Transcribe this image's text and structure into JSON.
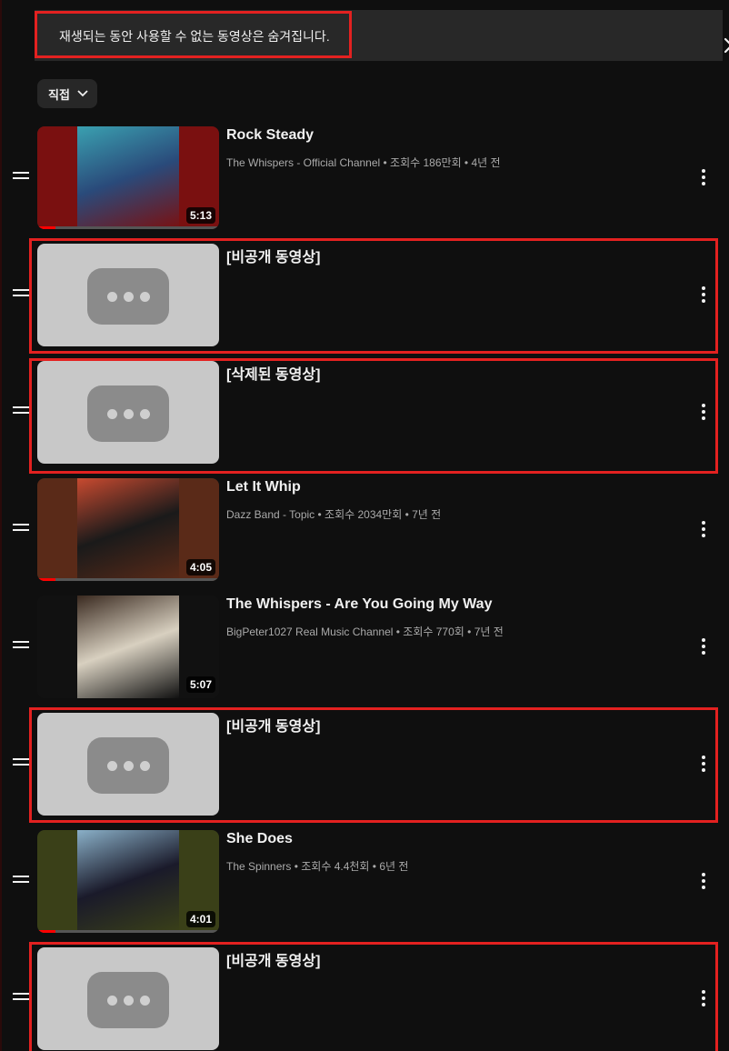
{
  "banner": {
    "message": "재생되는 동안 사용할 수 없는 동영상은 숨겨집니다.",
    "close_icon": "close-icon"
  },
  "sort_chip": {
    "label": "직접",
    "icon": "chevron-down-icon"
  },
  "videos": [
    {
      "title": "Rock Steady",
      "meta": "The Whispers - Official Channel • 조회수 186만회 • 4년 전",
      "duration": "5:13",
      "available": true,
      "progress": 0.1,
      "thumb_colors": [
        "#7a1010",
        "#2a4a7a",
        "#3aa0b0"
      ]
    },
    {
      "title": "[비공개 동영상]",
      "meta": "",
      "duration": "",
      "available": false
    },
    {
      "title": "[삭제된 동영상]",
      "meta": "",
      "duration": "",
      "available": false
    },
    {
      "title": "Let It Whip",
      "meta": "Dazz Band - Topic • 조회수 2034만회 • 7년 전",
      "duration": "4:05",
      "available": true,
      "progress": 0.1,
      "thumb_colors": [
        "#5a2a18",
        "#1a1a1a",
        "#c84a30"
      ]
    },
    {
      "title": "The Whispers - Are You Going My Way",
      "meta": "BigPeter1027 Real Music Channel • 조회수 770회 • 7년 전",
      "duration": "5:07",
      "available": true,
      "progress": 0,
      "thumb_colors": [
        "#111111",
        "#d8d0c0",
        "#3a2a20"
      ]
    },
    {
      "title": "[비공개 동영상]",
      "meta": "",
      "duration": "",
      "available": false
    },
    {
      "title": "She Does",
      "meta": "The Spinners • 조회수 4.4천회 • 6년 전",
      "duration": "4:01",
      "available": true,
      "progress": 0.1,
      "thumb_colors": [
        "#3a4018",
        "#1a1a2a",
        "#8ab0c8"
      ]
    },
    {
      "title": "[비공개 동영상]",
      "meta": "",
      "duration": "",
      "available": false
    }
  ],
  "highlight_color": "#e32120"
}
